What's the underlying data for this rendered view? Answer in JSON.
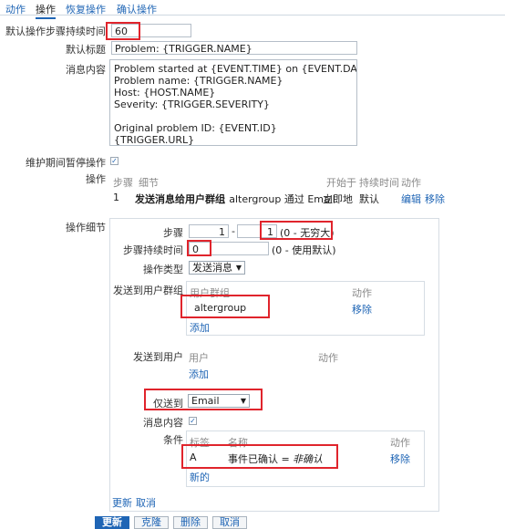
{
  "tabs": [
    "动作",
    "操作",
    "恢复操作",
    "确认操作"
  ],
  "default_step_duration": {
    "label": "默认操作步骤持续时间",
    "value": "60"
  },
  "default_subject": {
    "label": "默认标题",
    "value": "Problem: {TRIGGER.NAME}"
  },
  "message": {
    "label": "消息内容",
    "value": "Problem started at {EVENT.TIME} on {EVENT.DATE}\nProblem name: {TRIGGER.NAME}\nHost: {HOST.NAME}\nSeverity: {TRIGGER.SEVERITY}\n\nOriginal problem ID: {EVENT.ID}\n{TRIGGER.URL}"
  },
  "pause_maintenance": {
    "label": "维护期间暂停操作",
    "checked": true
  },
  "operations": {
    "label": "操作",
    "headers": {
      "steps": "步骤",
      "details": "细节",
      "start_in": "开始于",
      "duration": "持续时间",
      "action": "动作"
    },
    "row": {
      "step": "1",
      "details_bold": "发送消息给用户群组",
      "details_rest": ": altergroup 通过 Email",
      "start_in": "立即地",
      "duration": "默认",
      "edit": "编辑",
      "remove": "移除"
    }
  },
  "op_details": {
    "label": "操作细节",
    "steps": {
      "label": "步骤",
      "from": "1",
      "sep": "-",
      "to": "1",
      "hint": "(0 - 无穷大)"
    },
    "step_duration": {
      "label": "步骤持续时间",
      "value": "0",
      "hint": "(0 - 使用默认)"
    },
    "op_type": {
      "label": "操作类型",
      "value": "发送消息"
    },
    "user_groups": {
      "label": "发送到用户群组",
      "col_group": "用户群组",
      "col_action": "动作",
      "item": "altergroup",
      "remove": "移除",
      "add": "添加"
    },
    "users": {
      "label": "发送到用户",
      "col_user": "用户",
      "col_action": "动作",
      "add": "添加"
    },
    "send_only_to": {
      "label": "仅送到",
      "value": "Email"
    },
    "default_message": {
      "label": "消息内容",
      "checked": true
    },
    "conditions": {
      "label": "条件",
      "col_label": "标签",
      "col_name": "名称",
      "col_action": "动作",
      "row_label": "A",
      "row_name": "事件已确认 =",
      "row_value": "非确认",
      "remove": "移除",
      "new": "新的"
    },
    "update": "更新",
    "cancel": "取消"
  },
  "buttons": {
    "update": "更新",
    "clone": "克隆",
    "delete": "删除",
    "cancel": "取消"
  }
}
